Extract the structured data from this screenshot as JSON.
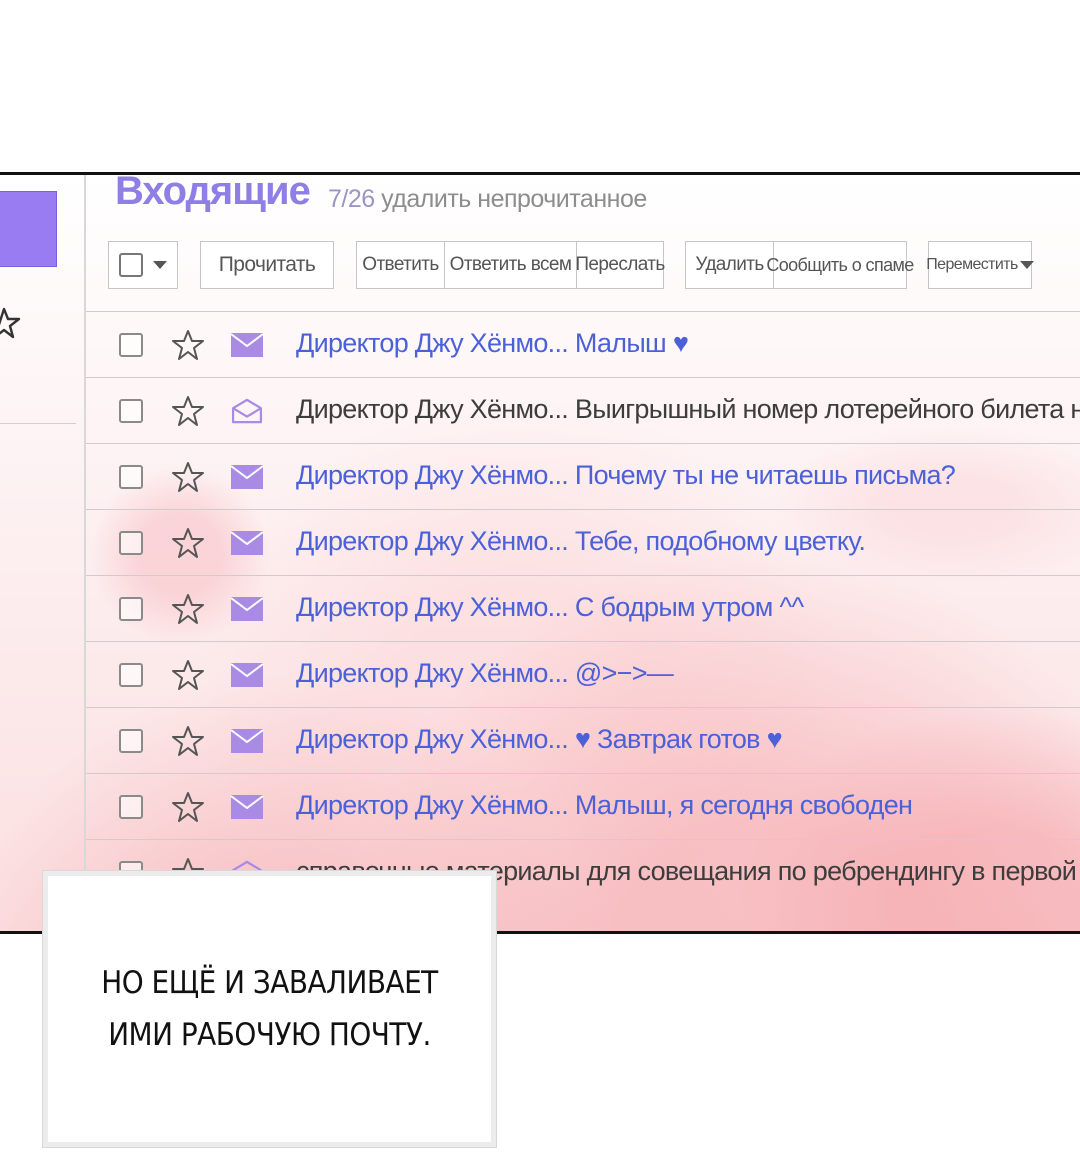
{
  "mailbox": {
    "title": "Входящие",
    "count": "7/26",
    "delete_unread": "удалить непрочитанное"
  },
  "toolbar": {
    "read": "Прочитать",
    "reply": "Ответить",
    "reply_all": "Ответить всем",
    "forward": "Переслать",
    "delete": "Удалить",
    "report_spam": "Сообщить о спаме",
    "move": "Переместить"
  },
  "messages": [
    {
      "text": "Директор Джу Хёнмо... Малыш ♥",
      "unread": true
    },
    {
      "text": "Директор Джу Хёнмо... Выигрышный номер лотерейного билета на следую",
      "unread": false
    },
    {
      "text": "Директор Джу Хёнмо... Почему ты не читаешь письма?",
      "unread": true
    },
    {
      "text": "Директор Джу Хёнмо... Тебе, подобному цветку.",
      "unread": true
    },
    {
      "text": "Директор Джу Хёнмо... С бодрым утром ^^",
      "unread": true
    },
    {
      "text": "Директор Джу Хёнмо... @>−>—",
      "unread": true
    },
    {
      "text": "Директор Джу Хёнмо... ♥ Завтрак готов ♥",
      "unread": true
    },
    {
      "text": "Директор Джу Хёнмо... Малыш, я сегодня свободен",
      "unread": true
    },
    {
      "text": "справочные материалы для совещания по ребрендингу в первой п",
      "unread": false
    }
  ],
  "caption": {
    "line1": "НО ЕЩЁ И ЗАВАЛИВАЕТ",
    "line2": "ИМИ РАБОЧУЮ ПОЧТУ."
  },
  "colors": {
    "accent": "#9a7cf2",
    "unread_text": "#4c61d8",
    "read_text": "#3d3d3d",
    "title": "#8f7ee6"
  }
}
